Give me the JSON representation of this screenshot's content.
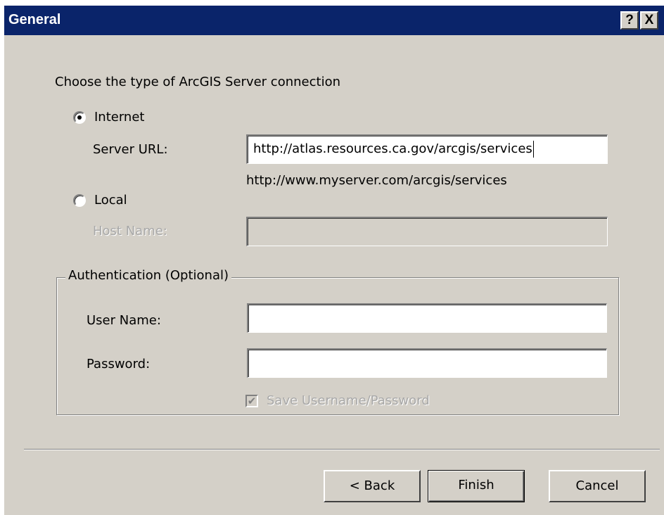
{
  "window": {
    "title": "General",
    "help_button": "?",
    "close_button": "X"
  },
  "main": {
    "prompt": "Choose the type of ArcGIS Server connection",
    "internet": {
      "label": "Internet",
      "selected": true,
      "server_url_label": "Server URL:",
      "server_url_value": "http://atlas.resources.ca.gov/arcgis/services",
      "example_url": "http://www.myserver.com/arcgis/services"
    },
    "local": {
      "label": "Local",
      "selected": false,
      "host_name_label": "Host Name:",
      "host_name_value": ""
    }
  },
  "authentication": {
    "legend": "Authentication (Optional)",
    "user_name_label": "User Name:",
    "user_name_value": "",
    "password_label": "Password:",
    "password_value": "",
    "save_label": "Save Username/Password",
    "save_checked": true,
    "save_enabled": false
  },
  "buttons": {
    "back": "< Back",
    "finish": "Finish",
    "cancel": "Cancel"
  },
  "colors": {
    "titlebar": "#0a246a",
    "dialog_face": "#d4d0c8",
    "disabled_text": "#a8a8a8"
  }
}
